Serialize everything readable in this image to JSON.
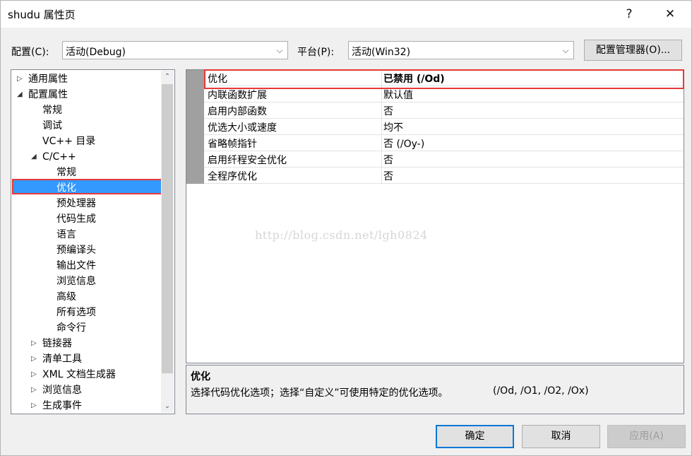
{
  "window": {
    "title": "shudu 属性页",
    "help_glyph": "?",
    "close_glyph": "✕"
  },
  "toolbar": {
    "config_label": "配置(C):",
    "config_value": "活动(Debug)",
    "platform_label": "平台(P):",
    "platform_value": "活动(Win32)",
    "config_manager_label": "配置管理器(O)..."
  },
  "tree": {
    "items": [
      {
        "label": "通用属性",
        "expander": "▷"
      },
      {
        "label": "配置属性",
        "expander": "◢"
      },
      {
        "label": "常规",
        "expander": ""
      },
      {
        "label": "调试",
        "expander": ""
      },
      {
        "label": "VC++ 目录",
        "expander": ""
      },
      {
        "label": "C/C++",
        "expander": "◢"
      },
      {
        "label": "常规",
        "expander": ""
      },
      {
        "label": "优化",
        "expander": "",
        "selected": true
      },
      {
        "label": "预处理器",
        "expander": ""
      },
      {
        "label": "代码生成",
        "expander": ""
      },
      {
        "label": "语言",
        "expander": ""
      },
      {
        "label": "预编译头",
        "expander": ""
      },
      {
        "label": "输出文件",
        "expander": ""
      },
      {
        "label": "浏览信息",
        "expander": ""
      },
      {
        "label": "高级",
        "expander": ""
      },
      {
        "label": "所有选项",
        "expander": ""
      },
      {
        "label": "命令行",
        "expander": ""
      },
      {
        "label": "链接器",
        "expander": "▷"
      },
      {
        "label": "清单工具",
        "expander": "▷"
      },
      {
        "label": "XML 文档生成器",
        "expander": "▷"
      },
      {
        "label": "浏览信息",
        "expander": "▷"
      },
      {
        "label": "生成事件",
        "expander": "▷"
      }
    ]
  },
  "properties": {
    "rows": [
      {
        "name": "优化",
        "value": "已禁用 (/Od)",
        "bold": true
      },
      {
        "name": "内联函数扩展",
        "value": "默认值"
      },
      {
        "name": "启用内部函数",
        "value": "否"
      },
      {
        "name": "优选大小或速度",
        "value": "均不"
      },
      {
        "name": "省略帧指针",
        "value": "否 (/Oy-)"
      },
      {
        "name": "启用纤程安全优化",
        "value": "否"
      },
      {
        "name": "全程序优化",
        "value": "否"
      }
    ]
  },
  "watermark": "http://blog.csdn.net/lgh0824",
  "description": {
    "title": "优化",
    "text": "选择代码优化选项；选择“自定义”可使用特定的优化选项。",
    "options": "(/Od, /O1, /O2, /Ox)"
  },
  "buttons": {
    "ok": "确定",
    "cancel": "取消",
    "apply": "应用(A)"
  },
  "colors": {
    "selection": "#3399ff",
    "highlight_box": "#e53935",
    "primary_border": "#0078d7"
  }
}
